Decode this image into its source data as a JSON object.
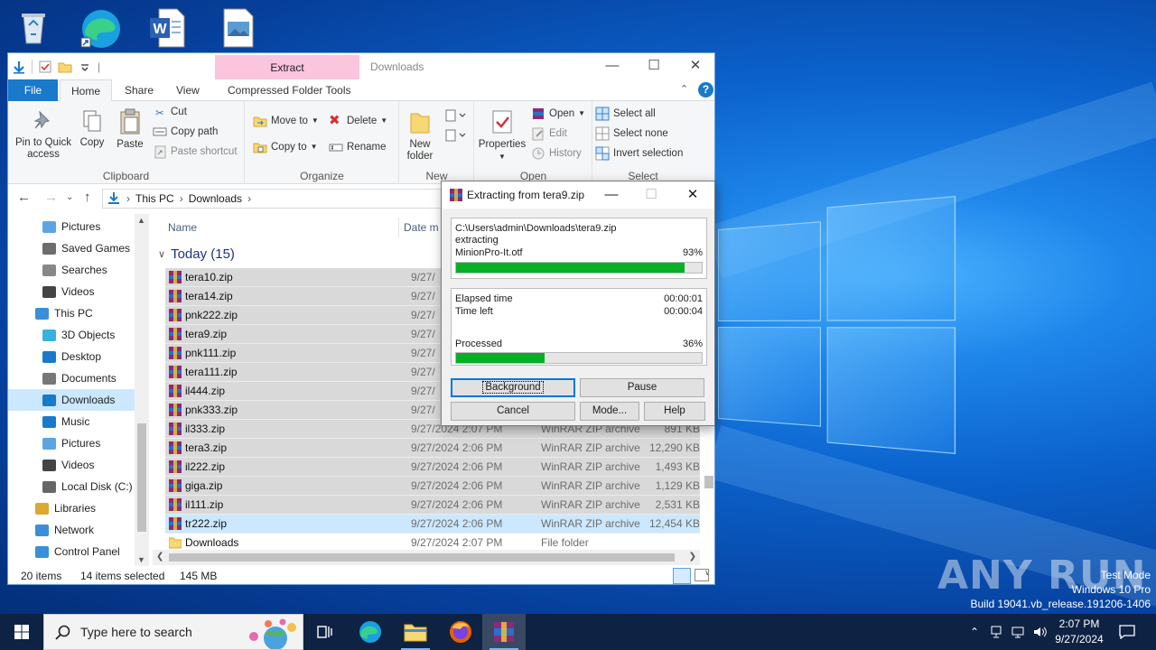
{
  "explorer": {
    "qat_separator": "|",
    "contextual_tab": "Extract",
    "title": "Downloads",
    "tabs": [
      "File",
      "Home",
      "Share",
      "View",
      "Compressed Folder Tools"
    ],
    "ribbon": {
      "clipboard": {
        "pin": "Pin to Quick access",
        "copy": "Copy",
        "paste": "Paste",
        "cut": "Cut",
        "copy_path": "Copy path",
        "paste_shortcut": "Paste shortcut",
        "label": "Clipboard"
      },
      "organize": {
        "move_to": "Move to",
        "copy_to": "Copy to",
        "delete": "Delete",
        "rename": "Rename",
        "label": "Organize"
      },
      "new": {
        "new_folder": "New folder",
        "label": "New"
      },
      "open": {
        "properties": "Properties",
        "open": "Open",
        "edit": "Edit",
        "history": "History",
        "label": "Open"
      },
      "select": {
        "select_all": "Select all",
        "select_none": "Select none",
        "invert": "Invert selection",
        "label": "Select"
      }
    },
    "address": [
      "This PC",
      "Downloads"
    ],
    "nav": [
      {
        "label": "Pictures",
        "icon": "pictures-icon"
      },
      {
        "label": "Saved Games",
        "icon": "saved-games-icon"
      },
      {
        "label": "Searches",
        "icon": "searches-icon"
      },
      {
        "label": "Videos",
        "icon": "videos-icon"
      },
      {
        "label": "This PC",
        "icon": "this-pc-icon"
      },
      {
        "label": "3D Objects",
        "icon": "3d-objects-icon"
      },
      {
        "label": "Desktop",
        "icon": "desktop-icon"
      },
      {
        "label": "Documents",
        "icon": "documents-icon"
      },
      {
        "label": "Downloads",
        "icon": "downloads-icon"
      },
      {
        "label": "Music",
        "icon": "music-icon"
      },
      {
        "label": "Pictures",
        "icon": "pictures-icon"
      },
      {
        "label": "Videos",
        "icon": "videos-icon"
      },
      {
        "label": "Local Disk (C:)",
        "icon": "drive-icon"
      },
      {
        "label": "Libraries",
        "icon": "libraries-icon"
      },
      {
        "label": "Network",
        "icon": "network-icon"
      },
      {
        "label": "Control Panel",
        "icon": "control-panel-icon"
      }
    ],
    "columns": {
      "name": "Name",
      "date": "Date m"
    },
    "group": "Today (15)",
    "files": [
      {
        "name": "tera10.zip",
        "date": "9/27/",
        "type": "",
        "size": ""
      },
      {
        "name": "tera14.zip",
        "date": "9/27/",
        "type": "",
        "size": ""
      },
      {
        "name": "pnk222.zip",
        "date": "9/27/",
        "type": "",
        "size": ""
      },
      {
        "name": "tera9.zip",
        "date": "9/27/",
        "type": "",
        "size": ""
      },
      {
        "name": "pnk111.zip",
        "date": "9/27/",
        "type": "",
        "size": ""
      },
      {
        "name": "tera111.zip",
        "date": "9/27/",
        "type": "",
        "size": ""
      },
      {
        "name": "il444.zip",
        "date": "9/27/",
        "type": "",
        "size": ""
      },
      {
        "name": "pnk333.zip",
        "date": "9/27/",
        "type": "",
        "size": ""
      },
      {
        "name": "il333.zip",
        "date": "9/27/2024 2:07 PM",
        "type": "WinRAR ZIP archive",
        "size": "891 KB"
      },
      {
        "name": "tera3.zip",
        "date": "9/27/2024 2:06 PM",
        "type": "WinRAR ZIP archive",
        "size": "12,290 KB"
      },
      {
        "name": "il222.zip",
        "date": "9/27/2024 2:06 PM",
        "type": "WinRAR ZIP archive",
        "size": "1,493 KB"
      },
      {
        "name": "giga.zip",
        "date": "9/27/2024 2:06 PM",
        "type": "WinRAR ZIP archive",
        "size": "1,129 KB"
      },
      {
        "name": "il111.zip",
        "date": "9/27/2024 2:06 PM",
        "type": "WinRAR ZIP archive",
        "size": "2,531 KB"
      },
      {
        "name": "tr222.zip",
        "date": "9/27/2024 2:06 PM",
        "type": "WinRAR ZIP archive",
        "size": "12,454 KB"
      },
      {
        "name": "Downloads",
        "date": "9/27/2024 2:07 PM",
        "type": "File folder",
        "size": ""
      }
    ],
    "status": {
      "items": "20 items",
      "selected": "14 items selected",
      "size": "145 MB"
    }
  },
  "dialog": {
    "title": "Extracting from tera9.zip",
    "path": "C:\\Users\\admin\\Downloads\\tera9.zip",
    "action": "extracting",
    "file": "MinionPro-It.otf",
    "file_percent_text": "93%",
    "file_progress": 0.93,
    "elapsed_label": "Elapsed time",
    "elapsed": "00:00:01",
    "left_label": "Time left",
    "left": "00:00:04",
    "processed_label": "Processed",
    "processed_percent_text": "36%",
    "processed_progress": 0.36,
    "buttons": {
      "background": "Background",
      "pause": "Pause",
      "cancel": "Cancel",
      "mode": "Mode...",
      "help": "Help"
    }
  },
  "desktop": {
    "watermark": "ANY RUN",
    "test_mode": [
      "Test Mode",
      "Windows 10 Pro",
      "Build 19041.vb_release.191206-1406"
    ]
  },
  "taskbar": {
    "search_placeholder": "Type here to search",
    "time": "2:07 PM",
    "date": "9/27/2024"
  },
  "colors": {
    "accent": "#1979ca",
    "progress": "#06b025",
    "taskbar": "#0e2243",
    "selection": "#cce8ff"
  }
}
